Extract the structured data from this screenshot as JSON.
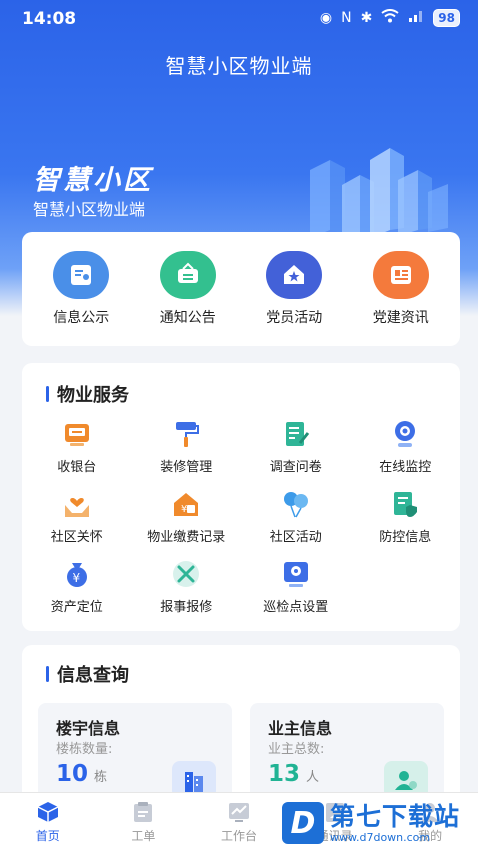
{
  "status_bar": {
    "time": "14:08",
    "battery": "98"
  },
  "header": {
    "title": "智慧小区物业端"
  },
  "hero": {
    "title": "智慧小区",
    "subtitle": "智慧小区物业端"
  },
  "quick_links": [
    {
      "label": "信息公示",
      "icon": "info-board-icon",
      "color": "#4a8fe8"
    },
    {
      "label": "通知公告",
      "icon": "notice-icon",
      "color": "#33c08f"
    },
    {
      "label": "党员活动",
      "icon": "party-star-icon",
      "color": "#4361d8"
    },
    {
      "label": "党建资讯",
      "icon": "news-icon",
      "color": "#f47a3c"
    }
  ],
  "services": {
    "title": "物业服务",
    "items": [
      {
        "label": "收银台",
        "icon": "cashier-icon"
      },
      {
        "label": "装修管理",
        "icon": "paint-roller-icon"
      },
      {
        "label": "调查问卷",
        "icon": "survey-icon"
      },
      {
        "label": "在线监控",
        "icon": "camera-icon"
      },
      {
        "label": "社区关怀",
        "icon": "care-hands-icon"
      },
      {
        "label": "物业缴费记录",
        "icon": "payment-house-icon"
      },
      {
        "label": "社区活动",
        "icon": "balloons-icon"
      },
      {
        "label": "防控信息",
        "icon": "shield-doc-icon"
      },
      {
        "label": "资产定位",
        "icon": "asset-bag-icon"
      },
      {
        "label": "报事报修",
        "icon": "repair-tools-icon"
      },
      {
        "label": "巡检点设置",
        "icon": "inspection-icon"
      }
    ]
  },
  "info_query": {
    "title": "信息查询",
    "boxes": [
      {
        "title": "楼宇信息",
        "sub": "楼栋数量:",
        "value": "10",
        "unit": "栋",
        "color": "#2b63e8",
        "icon": "building-icon"
      },
      {
        "title": "业主信息",
        "sub": "业主总数:",
        "value": "13",
        "unit": "人",
        "color": "#21b394",
        "icon": "owner-icon"
      }
    ]
  },
  "tabs": [
    {
      "label": "首页",
      "icon": "home-cube-icon",
      "active": true
    },
    {
      "label": "工单",
      "icon": "workorder-icon",
      "active": false
    },
    {
      "label": "工作台",
      "icon": "dashboard-chart-icon",
      "active": false
    },
    {
      "label": "通讯录",
      "icon": "contacts-icon",
      "active": false
    },
    {
      "label": "我的",
      "icon": "profile-icon",
      "active": false
    }
  ],
  "watermark": {
    "logo": "D",
    "main": "第七下载站",
    "url": "www.d7down.com"
  }
}
